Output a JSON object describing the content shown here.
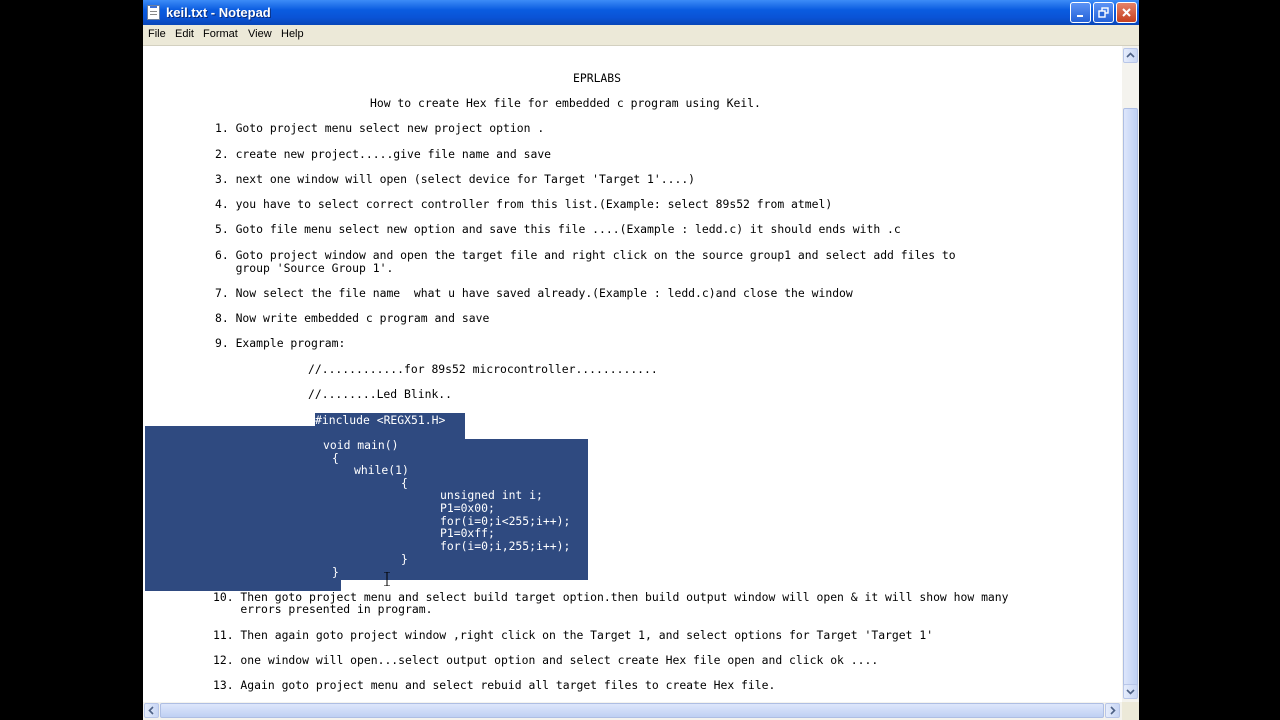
{
  "window": {
    "title": "keil.txt - Notepad"
  },
  "menubar": {
    "items": [
      "File",
      "Edit",
      "Format",
      "View",
      "Help"
    ]
  },
  "document": {
    "heading": "EPRLABS",
    "subheading": "How to create Hex file for embedded c program using Keil.",
    "steps": [
      "1. Goto project menu select new project option .",
      "2. create new project.....give file name and save",
      "3. next one window will open (select device for Target 'Target 1'....)",
      "4. you have to select correct controller from this list.(Example: select 89s52 from atmel)",
      "5. Goto file menu select new option and save this file ....(Example : ledd.c) it should ends with .c",
      "6. Goto project window and open the target file and right click on the source group1 and select add files to",
      "   group 'Source Group 1'.",
      "7. Now select the file name  what u have saved already.(Example : ledd.c)and close the window",
      "8. Now write embedded c program and save",
      "9. Example program:"
    ],
    "comments": [
      "//............for 89s52 microcontroller............",
      "//........Led Blink.."
    ],
    "code": [
      "#include <REGX51.H>",
      "void main()",
      "{",
      "while(1)",
      "{",
      "unsigned int i;",
      "P1=0x00;",
      "for(i=0;i<255;i++);",
      "P1=0xff;",
      "for(i=0;i,255;i++);",
      "}",
      "}"
    ],
    "steps_after": [
      "10. Then goto project menu and select build target option.then build output window will open & it will show how many",
      "    errors presented in program.",
      "11. Then again goto project window ,right click on the Target 1, and select options for Target 'Target 1'",
      "12. one window will open...select output option and select create Hex file open and click ok ....",
      "13. Again goto project menu and select rebuid all target files to create Hex file."
    ]
  },
  "colors": {
    "selection": "#2f4a80",
    "titlebar": "#0a5ce0",
    "menubar": "#ece9d8"
  }
}
